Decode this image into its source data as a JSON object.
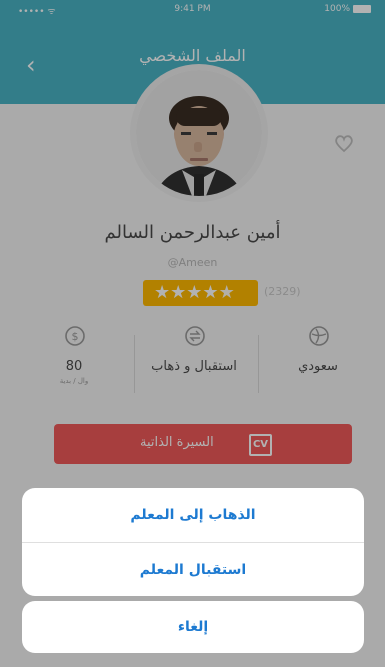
{
  "status_bar": {
    "signal": "••••• ᯤ",
    "time": "9:41 PM",
    "battery": "100%"
  },
  "header": {
    "title": "الملف الشخصي"
  },
  "profile": {
    "name": "أمين عبدالرحمن السالم",
    "handle": "@Ameen",
    "rating_stars": 4,
    "rating_max": 5,
    "rating_count": "(2329)"
  },
  "stats": [
    {
      "value": "80",
      "sub": "وال / بدية",
      "icon": "dollar-circle-icon"
    },
    {
      "value": "استقبال و ذهاب",
      "sub": "",
      "icon": "exchange-icon"
    },
    {
      "value": "سعودي",
      "sub": "",
      "icon": "globe-icon"
    }
  ],
  "cv_button": {
    "label": "السيرة الذاتية",
    "badge": "CV"
  },
  "action_sheet": {
    "options": [
      {
        "label": "الذهاب إلى المعلم"
      },
      {
        "label": "استقبال المعلم"
      }
    ],
    "cancel_label": "إلغاء"
  },
  "colors": {
    "header": "#49b3c4",
    "accent_red": "#ef5a5a",
    "rating": "#ffb900",
    "action_blue": "#1d7ad1"
  }
}
